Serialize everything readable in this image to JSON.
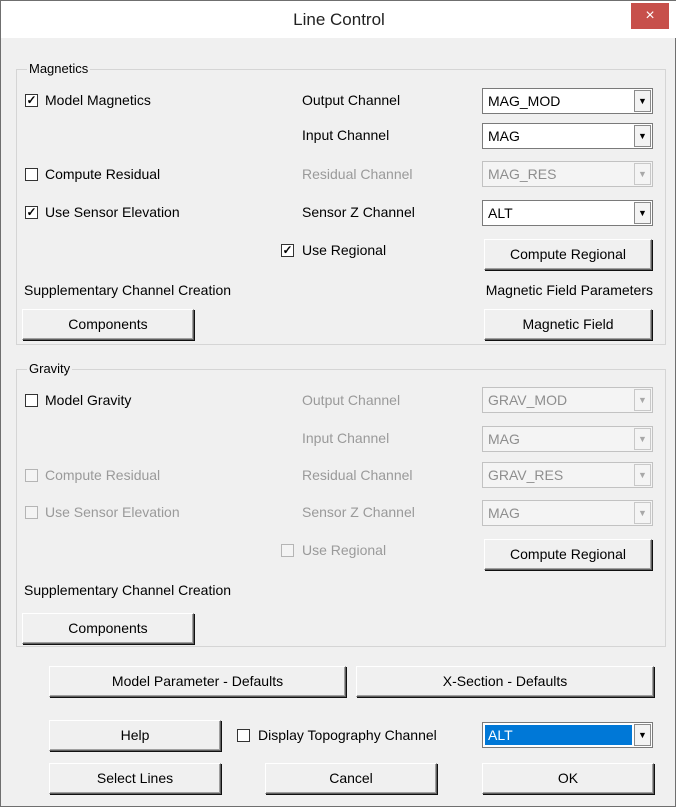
{
  "window": {
    "title": "Line Control",
    "close_glyph": "×"
  },
  "magnetics": {
    "group_title": "Magnetics",
    "model_label": "Model Magnetics",
    "compute_residual_label": "Compute Residual",
    "use_sensor_elevation_label": "Use Sensor Elevation",
    "use_regional_label": "Use Regional",
    "output_channel_label": "Output Channel",
    "output_channel_value": "MAG_MOD",
    "input_channel_label": "Input Channel",
    "input_channel_value": "MAG",
    "residual_channel_label": "Residual Channel",
    "residual_channel_value": "MAG_RES",
    "sensor_z_label": "Sensor Z Channel",
    "sensor_z_value": "ALT",
    "compute_regional_button": "Compute Regional",
    "supplementary_label": "Supplementary Channel Creation",
    "components_button": "Components",
    "field_params_label": "Magnetic Field Parameters",
    "magnetic_field_button": "Magnetic Field",
    "model_checked": true,
    "compute_residual_checked": false,
    "use_sensor_elevation_checked": true,
    "use_regional_checked": true
  },
  "gravity": {
    "group_title": "Gravity",
    "model_label": "Model Gravity",
    "compute_residual_label": "Compute Residual",
    "use_sensor_elevation_label": "Use Sensor Elevation",
    "use_regional_label": "Use Regional",
    "output_channel_label": "Output Channel",
    "output_channel_value": "GRAV_MOD",
    "input_channel_label": "Input Channel",
    "input_channel_value": "MAG",
    "residual_channel_label": "Residual Channel",
    "residual_channel_value": "GRAV_RES",
    "sensor_z_label": "Sensor Z Channel",
    "sensor_z_value": "MAG",
    "compute_regional_button": "Compute Regional",
    "supplementary_label": "Supplementary Channel Creation",
    "components_button": "Components",
    "model_checked": false,
    "compute_residual_checked": false,
    "use_sensor_elevation_checked": false,
    "use_regional_checked": false
  },
  "bottom": {
    "model_param_defaults_button": "Model Parameter - Defaults",
    "xsection_defaults_button": "X-Section - Defaults",
    "help_button": "Help",
    "display_topo_label": "Display Topography Channel",
    "display_topo_checked": false,
    "topo_channel_value": "ALT",
    "select_lines_button": "Select Lines",
    "cancel_button": "Cancel",
    "ok_button": "OK"
  },
  "icons": {
    "check": "✓",
    "dropdown_arrow": "▼"
  }
}
